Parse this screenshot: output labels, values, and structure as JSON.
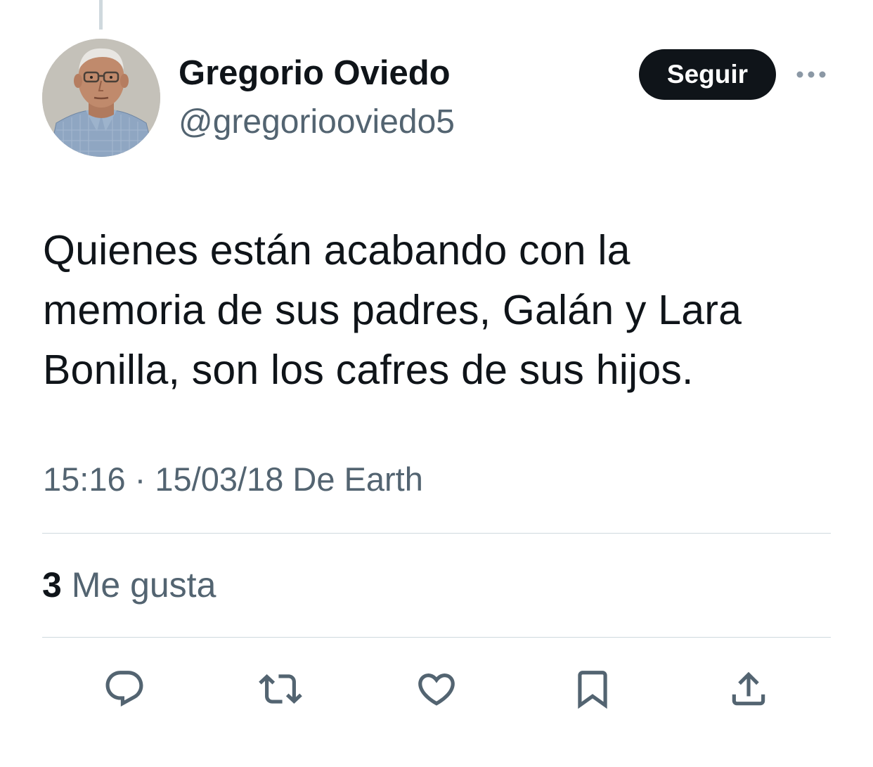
{
  "author": {
    "name": "Gregorio Oviedo",
    "handle": "@gregoriooviedo5",
    "follow_label": "Seguir"
  },
  "tweet": {
    "text": "Quienes están acabando con la\nmemoria de sus padres, Galán y Lara\nBonilla, son los cafres de sus hijos.",
    "meta": "15:16 · 15/03/18 De Earth"
  },
  "stats": {
    "likes_count": "3",
    "likes_label": "Me gusta"
  },
  "actions": {
    "icons": [
      "reply-icon",
      "retweet-icon",
      "like-icon",
      "bookmark-icon",
      "share-icon"
    ]
  },
  "colors": {
    "text_primary": "#0f1419",
    "text_secondary": "#536471",
    "divider": "#cfd9de",
    "button_bg": "#0f1419",
    "button_text": "#ffffff"
  }
}
